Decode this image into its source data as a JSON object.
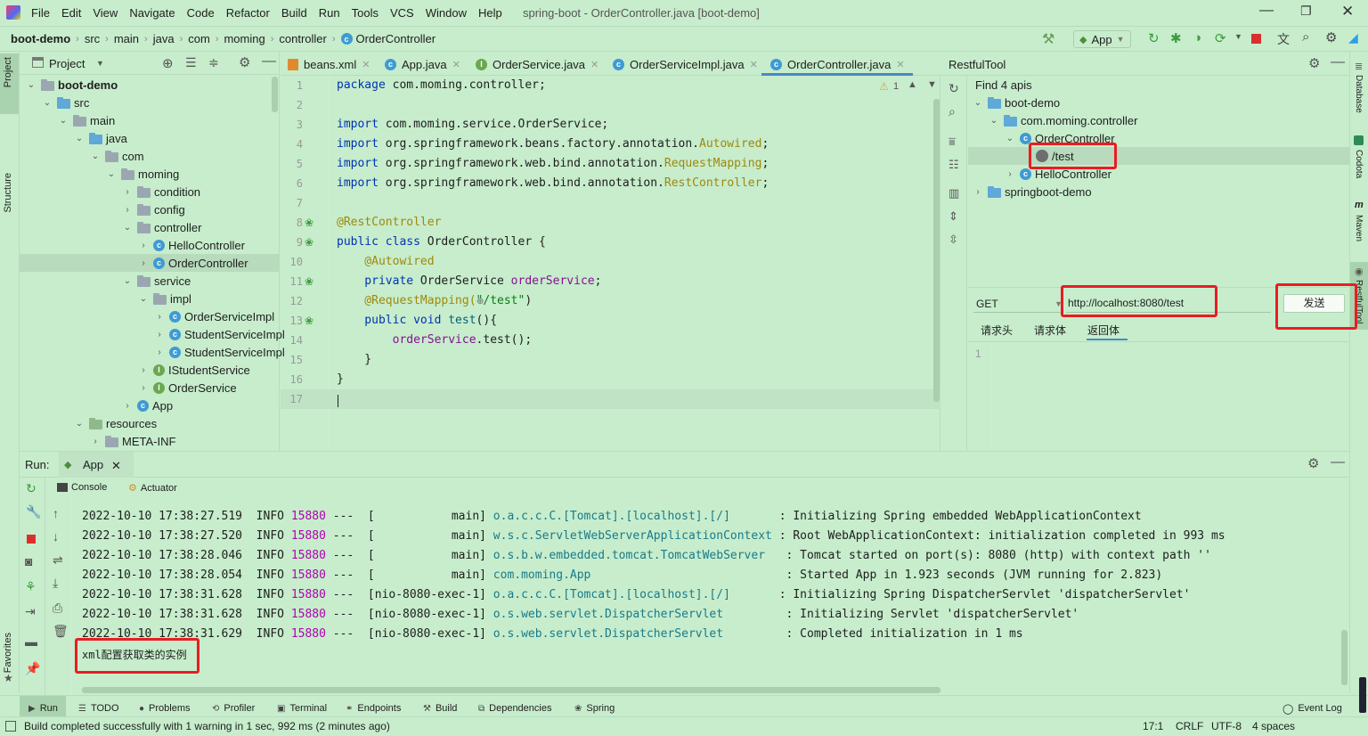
{
  "menu": {
    "items": [
      "File",
      "Edit",
      "View",
      "Navigate",
      "Code",
      "Refactor",
      "Build",
      "Run",
      "Tools",
      "VCS",
      "Window",
      "Help"
    ],
    "title": "spring-boot - OrderController.java [boot-demo]"
  },
  "breadcrumb": [
    "boot-demo",
    "src",
    "main",
    "java",
    "com",
    "moming",
    "controller",
    "OrderController"
  ],
  "toolbar": {
    "run_config": "App"
  },
  "project": {
    "header": "Project",
    "tree": [
      {
        "label": "boot-demo",
        "bold": true
      },
      {
        "label": "src"
      },
      {
        "label": "main"
      },
      {
        "label": "java"
      },
      {
        "label": "com"
      },
      {
        "label": "moming"
      },
      {
        "label": "condition"
      },
      {
        "label": "config"
      },
      {
        "label": "controller"
      },
      {
        "label": "HelloController"
      },
      {
        "label": "OrderController"
      },
      {
        "label": "service"
      },
      {
        "label": "impl"
      },
      {
        "label": "OrderServiceImpl"
      },
      {
        "label": "StudentServiceImpl"
      },
      {
        "label": "StudentServiceImpl"
      },
      {
        "label": "IStudentService"
      },
      {
        "label": "OrderService"
      },
      {
        "label": "App"
      },
      {
        "label": "resources"
      },
      {
        "label": "META-INF"
      }
    ]
  },
  "tabs": [
    {
      "label": "beans.xml"
    },
    {
      "label": "App.java"
    },
    {
      "label": "OrderService.java"
    },
    {
      "label": "OrderServiceImpl.java"
    },
    {
      "label": "OrderController.java",
      "active": true
    }
  ],
  "editor": {
    "warning_count": "1",
    "line_numbers": [
      "1",
      "2",
      "3",
      "4",
      "5",
      "6",
      "7",
      "8",
      "9",
      "10",
      "11",
      "12",
      "13",
      "14",
      "15",
      "16",
      "17"
    ],
    "lines": [
      {
        "a": "package",
        "b": " com.moming.controller;"
      },
      {
        "a": "",
        "b": ""
      },
      {
        "a": "import",
        "b": " com.moming.service.OrderService;"
      },
      {
        "a": "import",
        "b": " org.springframework.beans.factory.annotation.",
        "c": "Autowired",
        "d": ";"
      },
      {
        "a": "import",
        "b": " org.springframework.web.bind.annotation.",
        "c": "RequestMapping",
        "d": ";"
      },
      {
        "a": "import",
        "b": " org.springframework.web.bind.annotation.",
        "c": "RestController",
        "d": ";"
      },
      {
        "a": "",
        "b": ""
      },
      {
        "an": "@RestController"
      },
      {
        "a": "public class",
        "b": " OrderController {"
      },
      {
        "an": "    @Autowired"
      },
      {
        "a": "    private",
        "b": " OrderService ",
        "f": "orderService",
        "d": ";"
      },
      {
        "an": "    @RequestMapping(",
        "s": "\"/test\"",
        "e": ")"
      },
      {
        "a": "    public void",
        "b": " ",
        "m": "test",
        "d": "(){"
      },
      {
        "f": "        orderService",
        "b": ".test();"
      },
      {
        "b": "    }"
      },
      {
        "b": "}"
      },
      {
        "b": ""
      }
    ]
  },
  "restful": {
    "title": "RestfulTool",
    "find": "Find 4 apis",
    "tree": [
      {
        "label": "boot-demo"
      },
      {
        "label": "com.moming.controller"
      },
      {
        "label": "OrderController"
      },
      {
        "label": "/test"
      },
      {
        "label": "HelloController"
      },
      {
        "label": "springboot-demo"
      }
    ],
    "method": "GET",
    "url": "http://localhost:8080/test",
    "send": "发送",
    "subtabs": [
      "请求头",
      "请求体",
      "返回体"
    ],
    "body_line": "1"
  },
  "run": {
    "label": "Run:",
    "config": "App",
    "tabs": [
      "Console",
      "Actuator"
    ],
    "logs": [
      {
        "ts": "2022-10-10 17:38:27.519",
        "lvl": "INFO",
        "pid": "15880",
        "thr": "---  [           main]",
        "cls": "o.a.c.c.C.[Tomcat].[localhost].[/]      ",
        "msg": " : Initializing Spring embedded WebApplicationContext"
      },
      {
        "ts": "2022-10-10 17:38:27.520",
        "lvl": "INFO",
        "pid": "15880",
        "thr": "---  [           main]",
        "cls": "w.s.c.ServletWebServerApplicationContext",
        "msg": " : Root WebApplicationContext: initialization completed in 993 ms"
      },
      {
        "ts": "2022-10-10 17:38:28.046",
        "lvl": "INFO",
        "pid": "15880",
        "thr": "---  [           main]",
        "cls": "o.s.b.w.embedded.tomcat.TomcatWebServer  ",
        "msg": " : Tomcat started on port(s): 8080 (http) with context path ''"
      },
      {
        "ts": "2022-10-10 17:38:28.054",
        "lvl": "INFO",
        "pid": "15880",
        "thr": "---  [           main]",
        "cls": "com.moming.App                           ",
        "msg": " : Started App in 1.923 seconds (JVM running for 2.823)"
      },
      {
        "ts": "2022-10-10 17:38:31.628",
        "lvl": "INFO",
        "pid": "15880",
        "thr": "---  [nio-8080-exec-1]",
        "cls": "o.a.c.c.C.[Tomcat].[localhost].[/]      ",
        "msg": " : Initializing Spring DispatcherServlet 'dispatcherServlet'"
      },
      {
        "ts": "2022-10-10 17:38:31.628",
        "lvl": "INFO",
        "pid": "15880",
        "thr": "---  [nio-8080-exec-1]",
        "cls": "o.s.web.servlet.DispatcherServlet        ",
        "msg": " : Initializing Servlet 'dispatcherServlet'"
      },
      {
        "ts": "2022-10-10 17:38:31.629",
        "lvl": "INFO",
        "pid": "15880",
        "thr": "---  [nio-8080-exec-1]",
        "cls": "o.s.web.servlet.DispatcherServlet        ",
        "msg": " : Completed initialization in 1 ms"
      }
    ],
    "output": "xml配置获取类的实例"
  },
  "bottom_tabs": [
    "Run",
    "TODO",
    "Problems",
    "Profiler",
    "Terminal",
    "Endpoints",
    "Build",
    "Dependencies",
    "Spring"
  ],
  "event_log": "Event Log",
  "status": {
    "message": "Build completed successfully with 1 warning in 1 sec, 992 ms (2 minutes ago)",
    "pos": "17:1",
    "eol": "CRLF",
    "enc": "UTF-8",
    "indent": "4 spaces"
  },
  "side_labels": {
    "left": [
      "Project",
      "Structure",
      "Favorites"
    ],
    "right": [
      "Database",
      "Codota",
      "Maven",
      "RestfulTool"
    ]
  }
}
